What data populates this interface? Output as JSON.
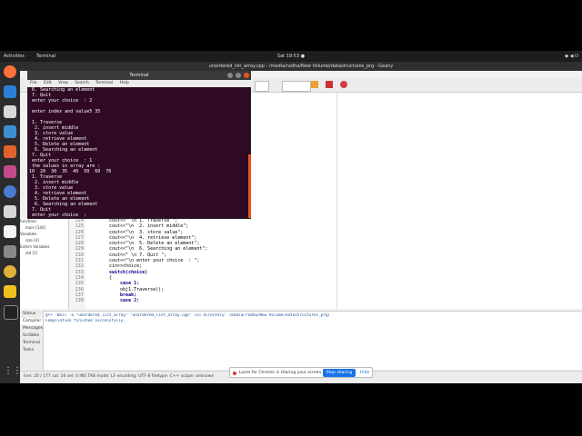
{
  "topbar": {
    "activities": "Activities",
    "app_menu": "Terminal",
    "clock": "Sat 19:53 ●"
  },
  "geany": {
    "title": "unordered_list_array.cpp - /media/radha/New Volume/datastructures_prg - Geany",
    "sidebar": [
      "functions",
      "main [144]",
      "Variables",
      "size [4]",
      "Extern Variables",
      "std [1]"
    ],
    "gutter": [
      "124",
      "125",
      "126",
      "127",
      "128",
      "129",
      "130",
      "131",
      "132",
      "133",
      "134",
      "135",
      "136",
      "137",
      "138"
    ],
    "code": [
      "cout<<\" \\n 1. Traverse \";",
      "cout<<\"\\n  2. insert middle\";",
      "cout<<\"\\n  3. store value\";",
      "cout<<\"\\n  4. retrieve element\";",
      "cout<<\"\\n  5. Delete an element\";",
      "cout<<\"\\n  6. Searching an element\";",
      "cout<<\" \\n 7. Quit \";",
      "cout<<\"\\n enter your choice  : \";",
      "cin>>choice;",
      "switch(choice)",
      "{",
      "    case 1:",
      "    obj1.Traverse();",
      "    break;",
      "    case 2:"
    ],
    "msg_tabs": [
      "Status",
      "Compiler",
      "Messages",
      "Scribble",
      "Terminal",
      "Tasks"
    ],
    "msg_lines": [
      "g++ -Wall -o \"unordered_list_array\" \"unordered_list_array.cpp\" (in directory: /media/radha/New Volume/datastructures_prg)",
      "Compilation finished successfully."
    ],
    "statusbar": "line: 20 / 177    col: 16    sel: 0    INS    TAB    mode: LF    encoding: UTF-8    filetype: C++    scope: unknown"
  },
  "sharebar": {
    "text": "Loom for Chrome is sharing your screen.",
    "stop_label": "Stop sharing",
    "hide_label": "Hide"
  },
  "terminal": {
    "title": "Terminal",
    "menu": [
      "File",
      "Edit",
      "View",
      "Search",
      "Terminal",
      "Help"
    ],
    "lines": [
      " 6. Searching an element",
      " 7. Quit",
      " enter your choice  : 2",
      "",
      " enter index and value5 35",
      "",
      " 1. Traverse",
      "  2. insert middle",
      "  3. store value",
      "  4. retrieve element",
      "  5. Delete an element",
      "  6. Searching an element",
      " 7. Quit",
      " enter your choice  : 1",
      " the values in array are :",
      "10  20  30  35  40  50  60  70",
      " 1. Traverse",
      "  2. insert middle",
      "  3. store value",
      "  4. retrieve element",
      "  5. Delete an element",
      "  6. Searching an element",
      " 7. Quit",
      " enter your choice  : "
    ]
  },
  "colors": {
    "terminal_bg": "#300a24",
    "accent": "#e95420",
    "share_button": "#1a73e8"
  }
}
